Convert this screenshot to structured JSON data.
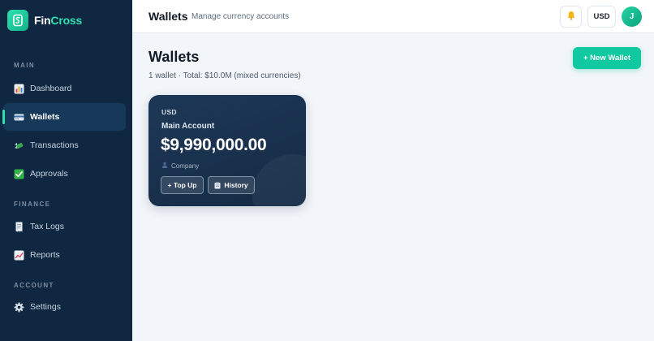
{
  "brand": {
    "name_main": "Fin",
    "name_accent": "Cross"
  },
  "sidebar": {
    "sections": [
      {
        "label": "MAIN"
      },
      {
        "label": "FINANCE"
      },
      {
        "label": "ACCOUNT"
      }
    ],
    "items": [
      {
        "label": "Dashboard",
        "icon": "bar-chart-icon"
      },
      {
        "label": "Wallets",
        "icon": "card-icon",
        "active": true
      },
      {
        "label": "Transactions",
        "icon": "money-wings-icon"
      },
      {
        "label": "Approvals",
        "icon": "check-box-icon"
      },
      {
        "label": "Tax Logs",
        "icon": "receipt-icon"
      },
      {
        "label": "Reports",
        "icon": "line-chart-icon"
      },
      {
        "label": "Settings",
        "icon": "gear-icon"
      }
    ]
  },
  "topbar": {
    "title": "Wallets",
    "subtitle": "Manage currency accounts",
    "currency": "USD",
    "avatar_initial": "J"
  },
  "main": {
    "title": "Wallets",
    "summary": "1 wallet · Total: $10.0M (mixed currencies)",
    "new_wallet_label": "+ New Wallet"
  },
  "wallets": [
    {
      "currency": "USD",
      "name": "Main Account",
      "balance": "$9,990,000.00",
      "owner": "Company",
      "top_up_label": "+ Top Up",
      "history_label": "History"
    }
  ],
  "colors": {
    "accent": "#10c9a0",
    "sidebar_bg": "#0f2740",
    "card_bg": "#1d3857",
    "page_bg": "#f2f5f9"
  }
}
